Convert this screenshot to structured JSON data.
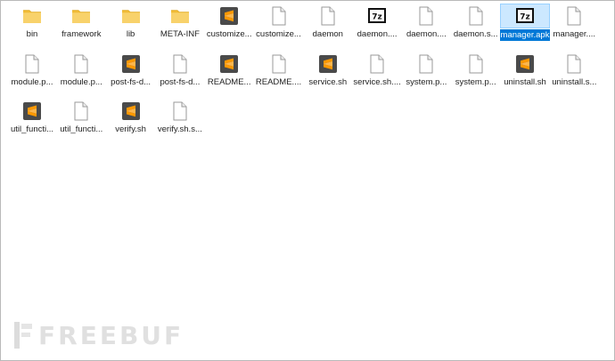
{
  "files": [
    {
      "name": "bin",
      "icon": "folder-icon"
    },
    {
      "name": "framework",
      "icon": "folder-icon"
    },
    {
      "name": "lib",
      "icon": "folder-icon"
    },
    {
      "name": "META-INF",
      "icon": "folder-icon"
    },
    {
      "name": "customize...",
      "icon": "sublime-icon"
    },
    {
      "name": "customize...",
      "icon": "document-icon"
    },
    {
      "name": "daemon",
      "icon": "document-icon"
    },
    {
      "name": "daemon....",
      "icon": "7z-icon"
    },
    {
      "name": "daemon....",
      "icon": "document-icon"
    },
    {
      "name": "daemon.s...",
      "icon": "document-icon"
    },
    {
      "name": "manager.apk",
      "icon": "7z-icon",
      "selected": true
    },
    {
      "name": "manager....",
      "icon": "document-icon"
    },
    {
      "name": "module.p...",
      "icon": "document-icon"
    },
    {
      "name": "module.p...",
      "icon": "document-icon"
    },
    {
      "name": "post-fs-d...",
      "icon": "sublime-icon"
    },
    {
      "name": "post-fs-d...",
      "icon": "document-icon"
    },
    {
      "name": "README...",
      "icon": "sublime-icon"
    },
    {
      "name": "README....",
      "icon": "document-icon"
    },
    {
      "name": "service.sh",
      "icon": "sublime-icon"
    },
    {
      "name": "service.sh....",
      "icon": "document-icon"
    },
    {
      "name": "system.p...",
      "icon": "document-icon"
    },
    {
      "name": "system.p...",
      "icon": "document-icon"
    },
    {
      "name": "uninstall.sh",
      "icon": "sublime-icon"
    },
    {
      "name": "uninstall.s...",
      "icon": "document-icon"
    },
    {
      "name": "util_functi...",
      "icon": "sublime-icon"
    },
    {
      "name": "util_functi...",
      "icon": "document-icon"
    },
    {
      "name": "verify.sh",
      "icon": "sublime-icon"
    },
    {
      "name": "verify.sh.s...",
      "icon": "document-icon"
    }
  ],
  "watermark": {
    "text": "FREEBUF",
    "icon": "freebuf-logo-icon"
  },
  "colors": {
    "folder": "#f4c542",
    "sublime_bg": "#4a4a4a",
    "sublime_mark": "#ff9800",
    "sevenzip_bg": "#111111",
    "selection": "#0078d7",
    "watermark": "#c7c7c7"
  }
}
